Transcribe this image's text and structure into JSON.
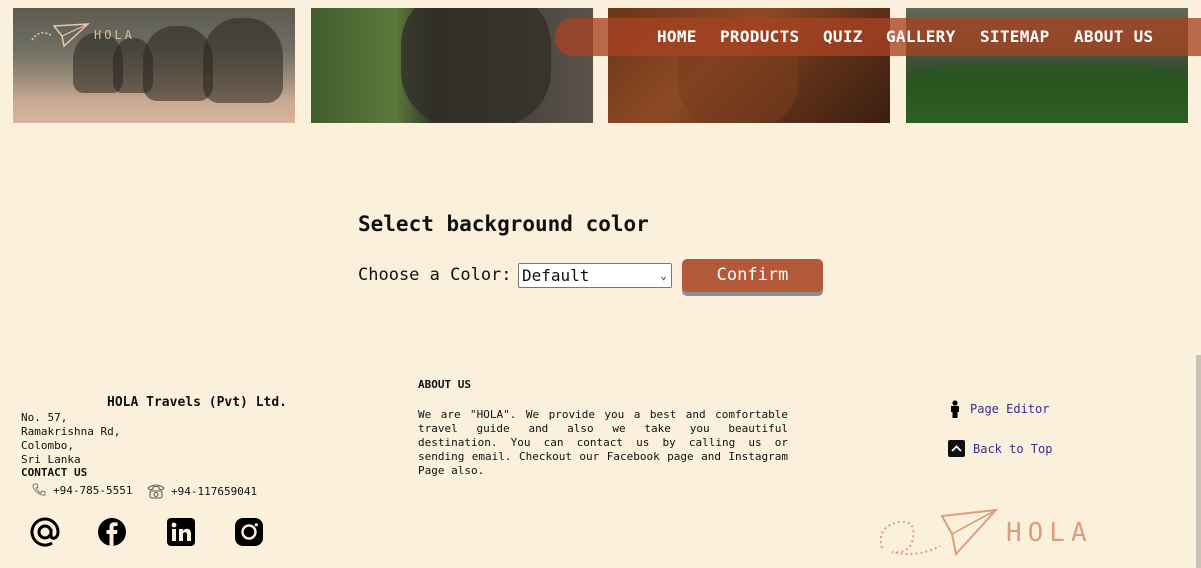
{
  "brand": {
    "name": "HOLA"
  },
  "nav": {
    "items": [
      {
        "label": "HOME"
      },
      {
        "label": "PRODUCTS"
      },
      {
        "label": "QUIZ"
      },
      {
        "label": "GALLERY"
      },
      {
        "label": "SITEMAP"
      },
      {
        "label": "ABOUT US"
      }
    ]
  },
  "main": {
    "title": "Select background color",
    "color_label": "Choose a Color:",
    "select_value": "Default",
    "confirm_label": "Confirm"
  },
  "footer": {
    "company": "HOLA Travels (Pvt) Ltd.",
    "address": [
      "No. 57,",
      "Ramakrishna Rd,",
      "Colombo,",
      "Sri Lanka"
    ],
    "contact_heading": "CONTACT US",
    "phone_mobile": "+94-785-5551",
    "phone_land": "+94-117659041",
    "about_heading": "ABOUT US",
    "about_text": "We are \"HOLA\". We provide you a best and comfortable travel guide and also we take you beautiful destination. You can contact us by calling us or sending email. Checkout our Facebook page and Instagram Page also.",
    "page_editor": "Page Editor",
    "back_to_top": "Back to Top",
    "social": [
      "at-icon",
      "facebook-icon",
      "linkedin-icon",
      "instagram-icon"
    ]
  },
  "colors": {
    "background": "#fbf0dc",
    "accent": "#b3593a",
    "nav_bg": "#a84222",
    "link": "#3a2c8c"
  }
}
